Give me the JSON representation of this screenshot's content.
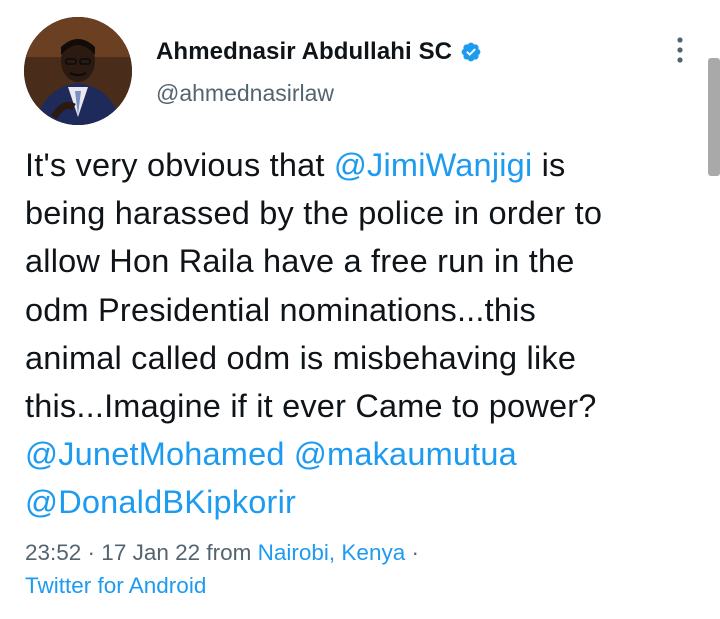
{
  "author": {
    "display_name": "Ahmednasir Abdullahi SC",
    "handle": "@ahmednasirlaw",
    "avatar_icon": "profile-photo"
  },
  "tweet": {
    "line1_pre": "It's very obvious that ",
    "mention_jimi": "@JimiWanjigi",
    "line1_post": " is",
    "line2": "being harassed by the police in order to",
    "line3": "allow Hon Raila have a free run in the",
    "line4": "odm Presidential nominations...this",
    "line5": "animal called odm is misbehaving like",
    "line6": "this...Imagine if it ever Came to power?",
    "mention_junet": "@JunetMohamed",
    "mention_makau": "@makaumutua",
    "mention_donald": "@DonaldBKipkorir"
  },
  "meta": {
    "time_date": "23:52 · 17 Jan 22 from ",
    "location": "Nairobi, Kenya",
    "sep": " ·",
    "source": "Twitter for Android"
  },
  "colors": {
    "link": "#1d9bf0",
    "secondary_text": "#536471",
    "primary_text": "#0f1419"
  }
}
